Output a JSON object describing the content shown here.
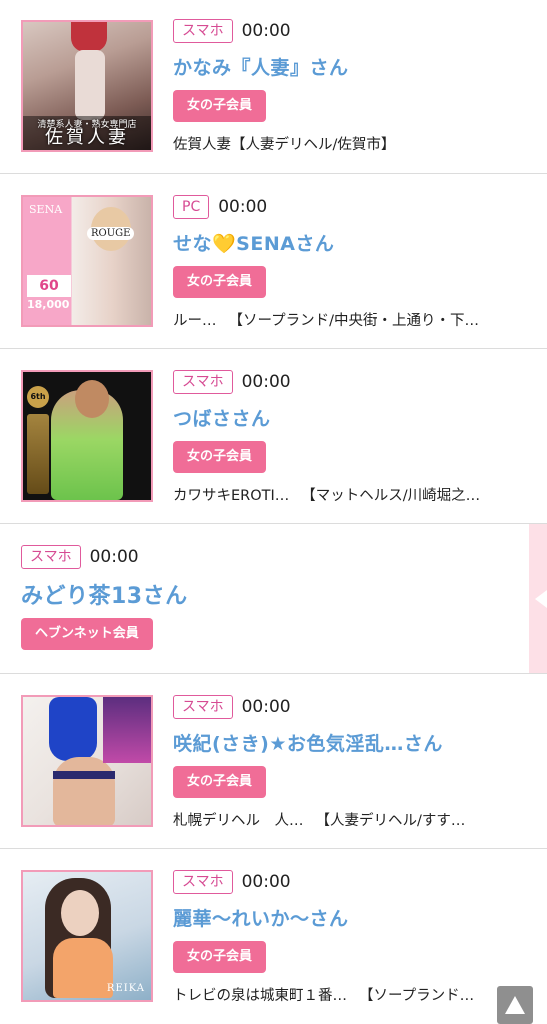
{
  "entries": [
    {
      "device": "スマホ",
      "time": "00:00",
      "name": "かなみ『人妻』さん",
      "badge": "女の子会員",
      "shop_name": "佐賀人妻【人妻デリヘル/佐賀市】",
      "shop_category": "",
      "thumb_caption_small": "清楚系人妻・熟女専門店",
      "thumb_caption_large": "佐賀人妻"
    },
    {
      "device": "PC",
      "time": "00:00",
      "name": "せな💛SENAさん",
      "badge": "女の子会員",
      "shop_name": "ルー…",
      "shop_category": "【ソープランド/中央街・上通り・下…",
      "thumb_caption_small": "SENA",
      "thumb_caption_large": "ROUGE",
      "thumb_price_minutes": "60",
      "thumb_price": "18,000"
    },
    {
      "device": "スマホ",
      "time": "00:00",
      "name": "つばささん",
      "badge": "女の子会員",
      "shop_name": "カワサキEROTI…",
      "shop_category": "【マットヘルス/川崎堀之…",
      "thumb_rank": "6th"
    },
    {
      "device": "スマホ",
      "time": "00:00",
      "name": "みどり茶13さん",
      "badge": "ヘブンネット会員"
    },
    {
      "device": "スマホ",
      "time": "00:00",
      "name": "咲紀(さき)★お色気淫乱…さん",
      "badge": "女の子会員",
      "shop_name": "札幌デリヘル　人…",
      "shop_category": "【人妻デリヘル/すす…"
    },
    {
      "device": "スマホ",
      "time": "00:00",
      "name": "麗華～れいか～さん",
      "badge": "女の子会員",
      "shop_name": "トレビの泉は城東町１番…",
      "shop_category": "【ソープランド…",
      "thumb_caption_large": "REIKA"
    }
  ],
  "colors": {
    "accent_pink": "#f06d97",
    "name_blue": "#5b9bd5",
    "device_border": "#e05a9c"
  },
  "icons": {
    "scroll_top": "arrow-up-icon",
    "side_tab": "chevron-left-icon"
  }
}
